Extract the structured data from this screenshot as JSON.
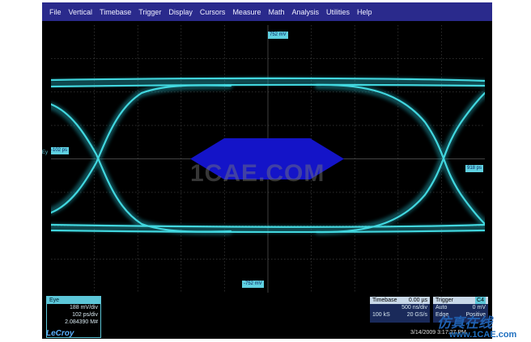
{
  "menu": [
    "File",
    "Vertical",
    "Timebase",
    "Trigger",
    "Display",
    "Cursors",
    "Measure",
    "Math",
    "Analysis",
    "Utilities",
    "Help"
  ],
  "markers": {
    "top_level": "752 mV",
    "bottom_level": "-752 mV",
    "left_time": "-102 ps",
    "right_time": "918 ps",
    "channel": "Ey"
  },
  "watermark": "1CAE.COM",
  "eye_panel": {
    "title": "Eye",
    "vdiv": "188 mV/div",
    "hdiv": "102 ps/div",
    "count": "2.084390 M#"
  },
  "timebase_panel": {
    "title": "Timebase",
    "delay": "0.00 µs",
    "tdiv": "500 ns/div",
    "samples": "100 kS",
    "rate": "20 GS/s"
  },
  "trigger_panel": {
    "title": "Trigger",
    "channel": "C4",
    "mode": "Auto",
    "level": "0 mV",
    "edge": "Edge",
    "slope": "Positive"
  },
  "brand": "LeCroy",
  "datetime": "3/14/2009 3:17:27 PM",
  "site": {
    "logo_text": "仿真在线",
    "url": "www.1CAE.com"
  },
  "colors": {
    "menubar": "#2a2a8c",
    "trace": "#40e0e8",
    "mask": "#1414c8",
    "grid": "#4a4a4a"
  }
}
